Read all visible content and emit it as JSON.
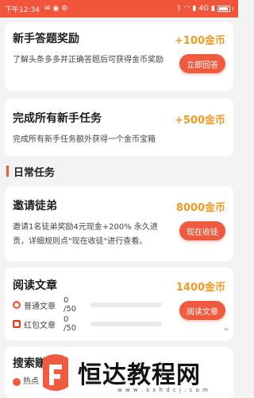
{
  "status_bar": {
    "time": "下午12:34",
    "network": "4G"
  },
  "tasks_newbie": [
    {
      "title": "新手答题奖励",
      "reward": "+100金币",
      "desc": "了解头条多多并正确答题后可获得金币奖励",
      "button": "立即回答"
    },
    {
      "title": "完成所有新手任务",
      "reward": "+500金币",
      "desc": "完成所有新手任务额外获得一个金币宝箱"
    }
  ],
  "section": {
    "title": "日常任务"
  },
  "invite": {
    "title": "邀请徒弟",
    "reward": "8000金币",
    "desc_line1": "邀请1名徒弟奖励4元现金+200% 永久进",
    "desc_line2": "贡，详细规则点\"现在收徒\"进行查看。",
    "button": "现在收徒"
  },
  "read": {
    "title": "阅读文章",
    "reward": "1400金币",
    "button": "阅读文章",
    "items": [
      {
        "label": "普通文章",
        "count": "0 /50",
        "progress": 0
      },
      {
        "label": "红包文章",
        "count": "0 /50",
        "progress": 0
      }
    ]
  },
  "search": {
    "title": "搜索赚",
    "sub": "热点"
  },
  "watermark": {
    "name": "恒达教程网",
    "url": "w w w . s x h d c j . c o m"
  },
  "colors": {
    "accent": "#f05a3f",
    "reward": "#f39a23",
    "status_bar": "#f2553b"
  }
}
